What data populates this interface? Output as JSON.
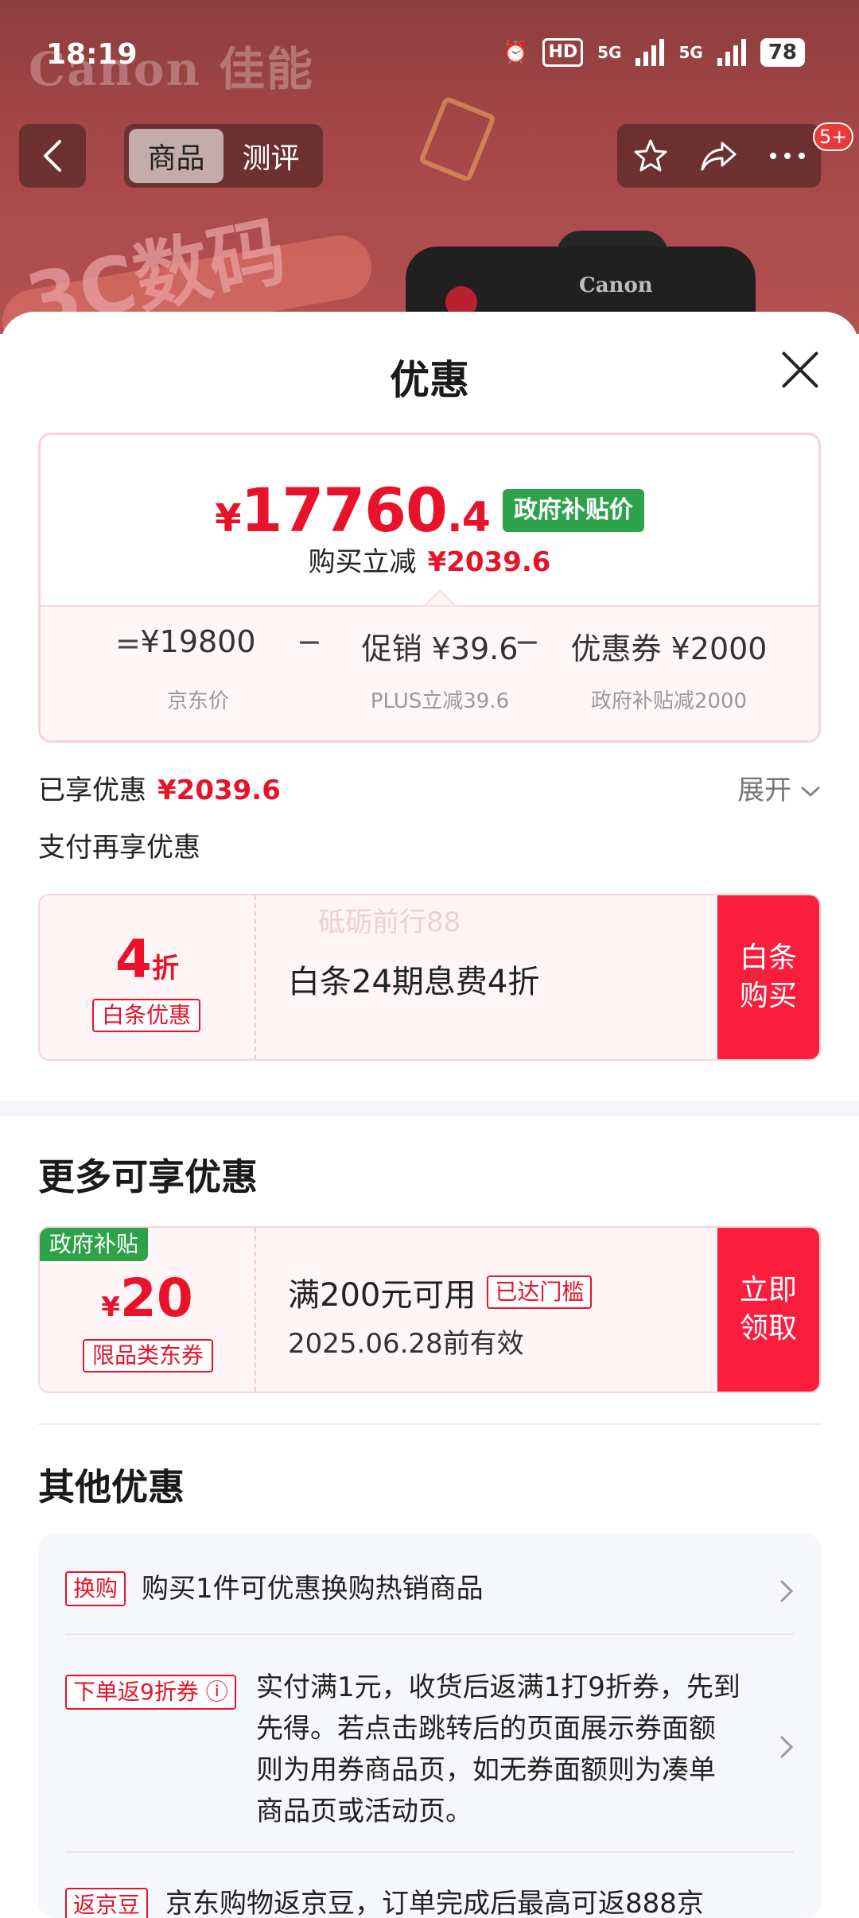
{
  "status_bar": {
    "time": "18:19",
    "hd_label": "HD",
    "network1": "5G",
    "network2": "5G",
    "battery": "78"
  },
  "background": {
    "brand_text": "Canon 佳能",
    "banner_text": "3C数码",
    "camera_brand": "Canon"
  },
  "nav": {
    "back_icon": "chevron-left",
    "tabs": [
      {
        "label": "商品",
        "active": true
      },
      {
        "label": "测评",
        "active": false
      }
    ],
    "actions": [
      "star-icon",
      "share-icon",
      "more-icon"
    ],
    "badge": "5+"
  },
  "sheet": {
    "title": "优惠",
    "price": {
      "yen": "¥",
      "integer": "17760",
      "decimal": ".4",
      "tag": "政府补贴价",
      "reduce_label": "购买立减",
      "reduce_value": "¥2039.6"
    },
    "formula": {
      "eq": "=",
      "minus1": "−",
      "minus2": "−",
      "item1_value": "¥19800",
      "item1_sub": "京东价",
      "item2_value": "促销 ¥39.6",
      "item2_sub": "PLUS立减39.6",
      "item3_value": "优惠券 ¥2000",
      "item3_sub": "政府补贴减2000"
    },
    "enjoyed_label": "已享优惠",
    "enjoyed_value": "¥2039.6",
    "expand_label": "展开",
    "pay_more_label": "支付再享优惠",
    "baitiao": {
      "discount_number": "4",
      "discount_unit": "折",
      "tag": "白条优惠",
      "text": "白条24期息费4折",
      "watermark": "砥砺前行88",
      "button": "白条购买"
    },
    "more_title": "更多可享优惠",
    "coupon": {
      "gov_tag": "政府补贴",
      "yen": "¥",
      "amount": "20",
      "type": "限品类东券",
      "condition": "满200元可用",
      "reached": "已达门槛",
      "valid": "2025.06.28前有效",
      "button": "立即领取"
    },
    "other_title": "其他优惠",
    "other_items": [
      {
        "tag": "换购",
        "text": "购买1件可优惠换购热销商品"
      },
      {
        "tag": "下单返9折券",
        "text": "实付满1元，收货后返满1打9折券，先到先得。若点击跳转后的页面展示券面额则为用券商品页，如无券面额则为凑单商品页或活动页。"
      },
      {
        "tag": "返京豆",
        "text": "京东购物返京豆，订单完成后最高可返888京"
      }
    ]
  }
}
